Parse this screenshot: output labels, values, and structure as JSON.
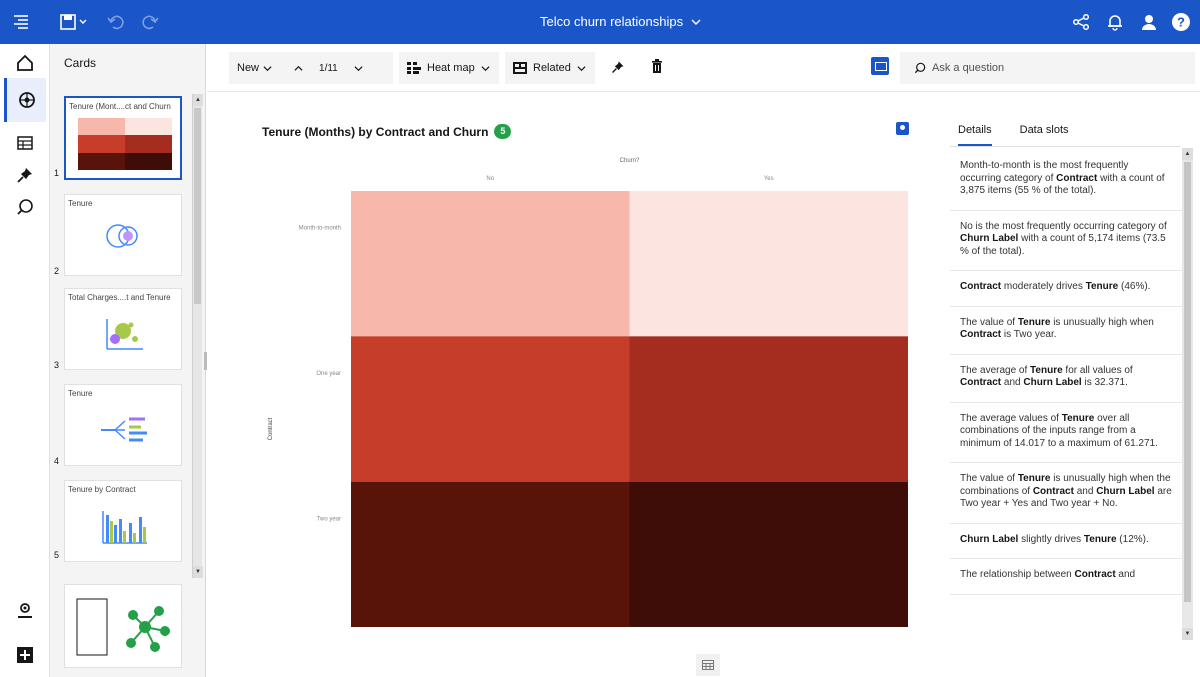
{
  "app": {
    "title": "Telco churn relationships",
    "brand_color": "#1a56c8"
  },
  "topbar": {
    "icons": [
      "menu-icon",
      "save-icon",
      "undo-icon",
      "redo-icon",
      "share-icon",
      "notification-icon",
      "user-icon",
      "help-icon"
    ]
  },
  "rail": {
    "icons": [
      "home-icon",
      "cards-icon",
      "data-icon",
      "pin-icon",
      "ask-icon",
      "profile-icon",
      "add-icon"
    ]
  },
  "cards_panel": {
    "title": "Cards",
    "cards": [
      {
        "title": "Tenure (Mont....ct and Churn",
        "number": "1"
      },
      {
        "title": "Tenure",
        "number": "2"
      },
      {
        "title": "Total Charges....t and Tenure",
        "number": "3"
      },
      {
        "title": "Tenure",
        "number": "4"
      },
      {
        "title": "Tenure by Contract",
        "number": "5"
      }
    ]
  },
  "toolbar": {
    "new_label": "New",
    "pager": "1/11",
    "viz_label": "Heat map",
    "related_label": "Related",
    "ask_placeholder": "Ask a question"
  },
  "chart": {
    "title": "Tenure (Months) by Contract and Churn",
    "badge": "5"
  },
  "chart_data": {
    "type": "heatmap",
    "title": "Tenure (Months) by Contract and Churn",
    "xlabel": "Churn?",
    "ylabel": "Contract",
    "x_categories": [
      "No",
      "Yes"
    ],
    "y_categories": [
      "Month-to-month",
      "One year",
      "Two year"
    ],
    "colors": [
      [
        "#f7b7ab",
        "#fce4e0"
      ],
      [
        "#c63d29",
        "#a42d1f"
      ],
      [
        "#581409",
        "#3f0d07"
      ]
    ]
  },
  "details": {
    "tabs": [
      "Details",
      "Data slots"
    ],
    "insights": [
      [
        {
          "t": "Month-to-month is the most frequently occurring category of "
        },
        {
          "b": "Contract"
        },
        {
          "t": " with a count of 3,875 items (55 % of the total)."
        }
      ],
      [
        {
          "t": "No is the most frequently occurring category of "
        },
        {
          "b": "Churn Label"
        },
        {
          "t": " with a count of 5,174 items (73.5 % of the total)."
        }
      ],
      [
        {
          "b": "Contract"
        },
        {
          "t": " moderately drives "
        },
        {
          "b": "Tenure"
        },
        {
          "t": " (46%)."
        }
      ],
      [
        {
          "t": "The value of "
        },
        {
          "b": "Tenure"
        },
        {
          "t": " is unusually high when "
        },
        {
          "b": "Contract"
        },
        {
          "t": " is Two year."
        }
      ],
      [
        {
          "t": "The average of "
        },
        {
          "b": "Tenure"
        },
        {
          "t": " for all values of "
        },
        {
          "b": "Contract"
        },
        {
          "t": " and "
        },
        {
          "b": "Churn Label"
        },
        {
          "t": " is 32.371."
        }
      ],
      [
        {
          "t": "The average values of "
        },
        {
          "b": "Tenure"
        },
        {
          "t": " over all combinations of the inputs range from a minimum of 14.017 to a maximum of 61.271."
        }
      ],
      [
        {
          "t": "The value of "
        },
        {
          "b": "Tenure"
        },
        {
          "t": " is unusually high when the combinations of "
        },
        {
          "b": "Contract"
        },
        {
          "t": " and "
        },
        {
          "b": "Churn Label"
        },
        {
          "t": " are Two year + Yes and Two year + No."
        }
      ],
      [
        {
          "b": "Churn Label"
        },
        {
          "t": " slightly drives "
        },
        {
          "b": "Tenure"
        },
        {
          "t": " (12%)."
        }
      ],
      [
        {
          "t": "The relationship between "
        },
        {
          "b": "Contract"
        },
        {
          "t": " and"
        }
      ]
    ]
  }
}
